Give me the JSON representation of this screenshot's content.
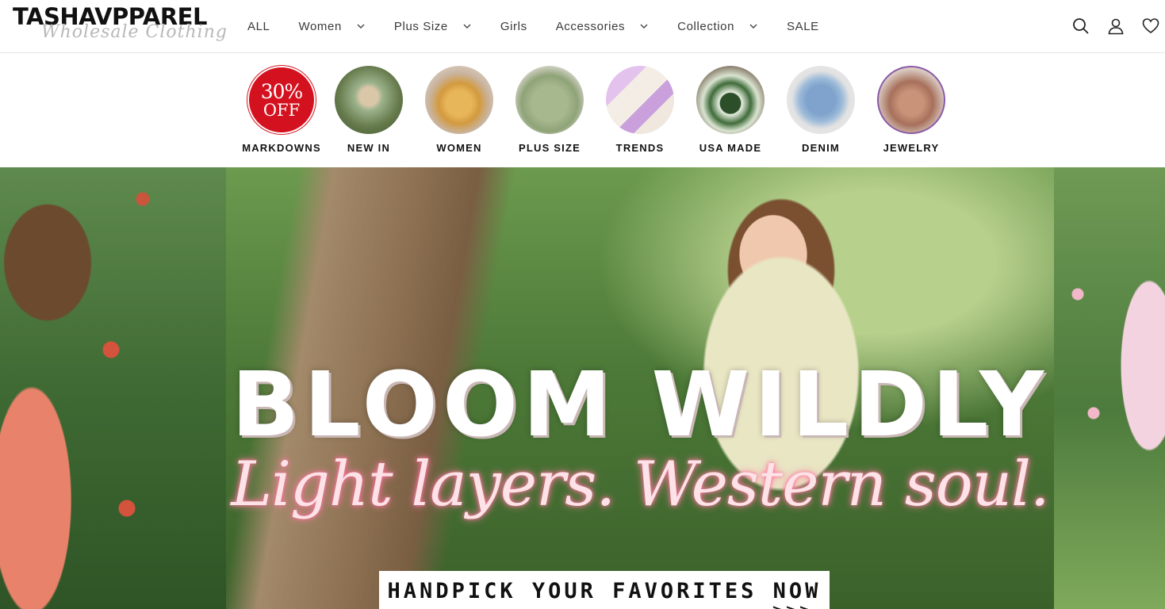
{
  "brand": {
    "name": "TASHAVPPAREL",
    "tagline": "Wholesale Clothing"
  },
  "nav": {
    "items": [
      {
        "label": "ALL",
        "has_dropdown": false
      },
      {
        "label": "Women",
        "has_dropdown": true
      },
      {
        "label": "Plus Size",
        "has_dropdown": true
      },
      {
        "label": "Girls",
        "has_dropdown": false
      },
      {
        "label": "Accessories",
        "has_dropdown": true
      },
      {
        "label": "Collection",
        "has_dropdown": true
      },
      {
        "label": "SALE",
        "has_dropdown": false
      }
    ]
  },
  "header_icons": [
    "search-icon",
    "account-icon",
    "wishlist-heart-icon"
  ],
  "categories": [
    {
      "label": "MARKDOWNS",
      "badge_line1": "30%",
      "badge_line2": "OFF"
    },
    {
      "label": "NEW IN"
    },
    {
      "label": "WOMEN"
    },
    {
      "label": "PLUS SIZE"
    },
    {
      "label": "TRENDS"
    },
    {
      "label": "USA MADE"
    },
    {
      "label": "DENIM"
    },
    {
      "label": "JEWELRY"
    }
  ],
  "hero": {
    "headline": "BLOOM WILDLY",
    "tagline": "Light layers. Western soul.",
    "cta": "HANDPICK YOUR FAVORITES NOW",
    "cta_arrows": ">>>"
  },
  "colors": {
    "markdown_red": "#d4121f",
    "jewelry_ring": "#8a5ba6",
    "tagline_pink": "#fde2e8"
  }
}
